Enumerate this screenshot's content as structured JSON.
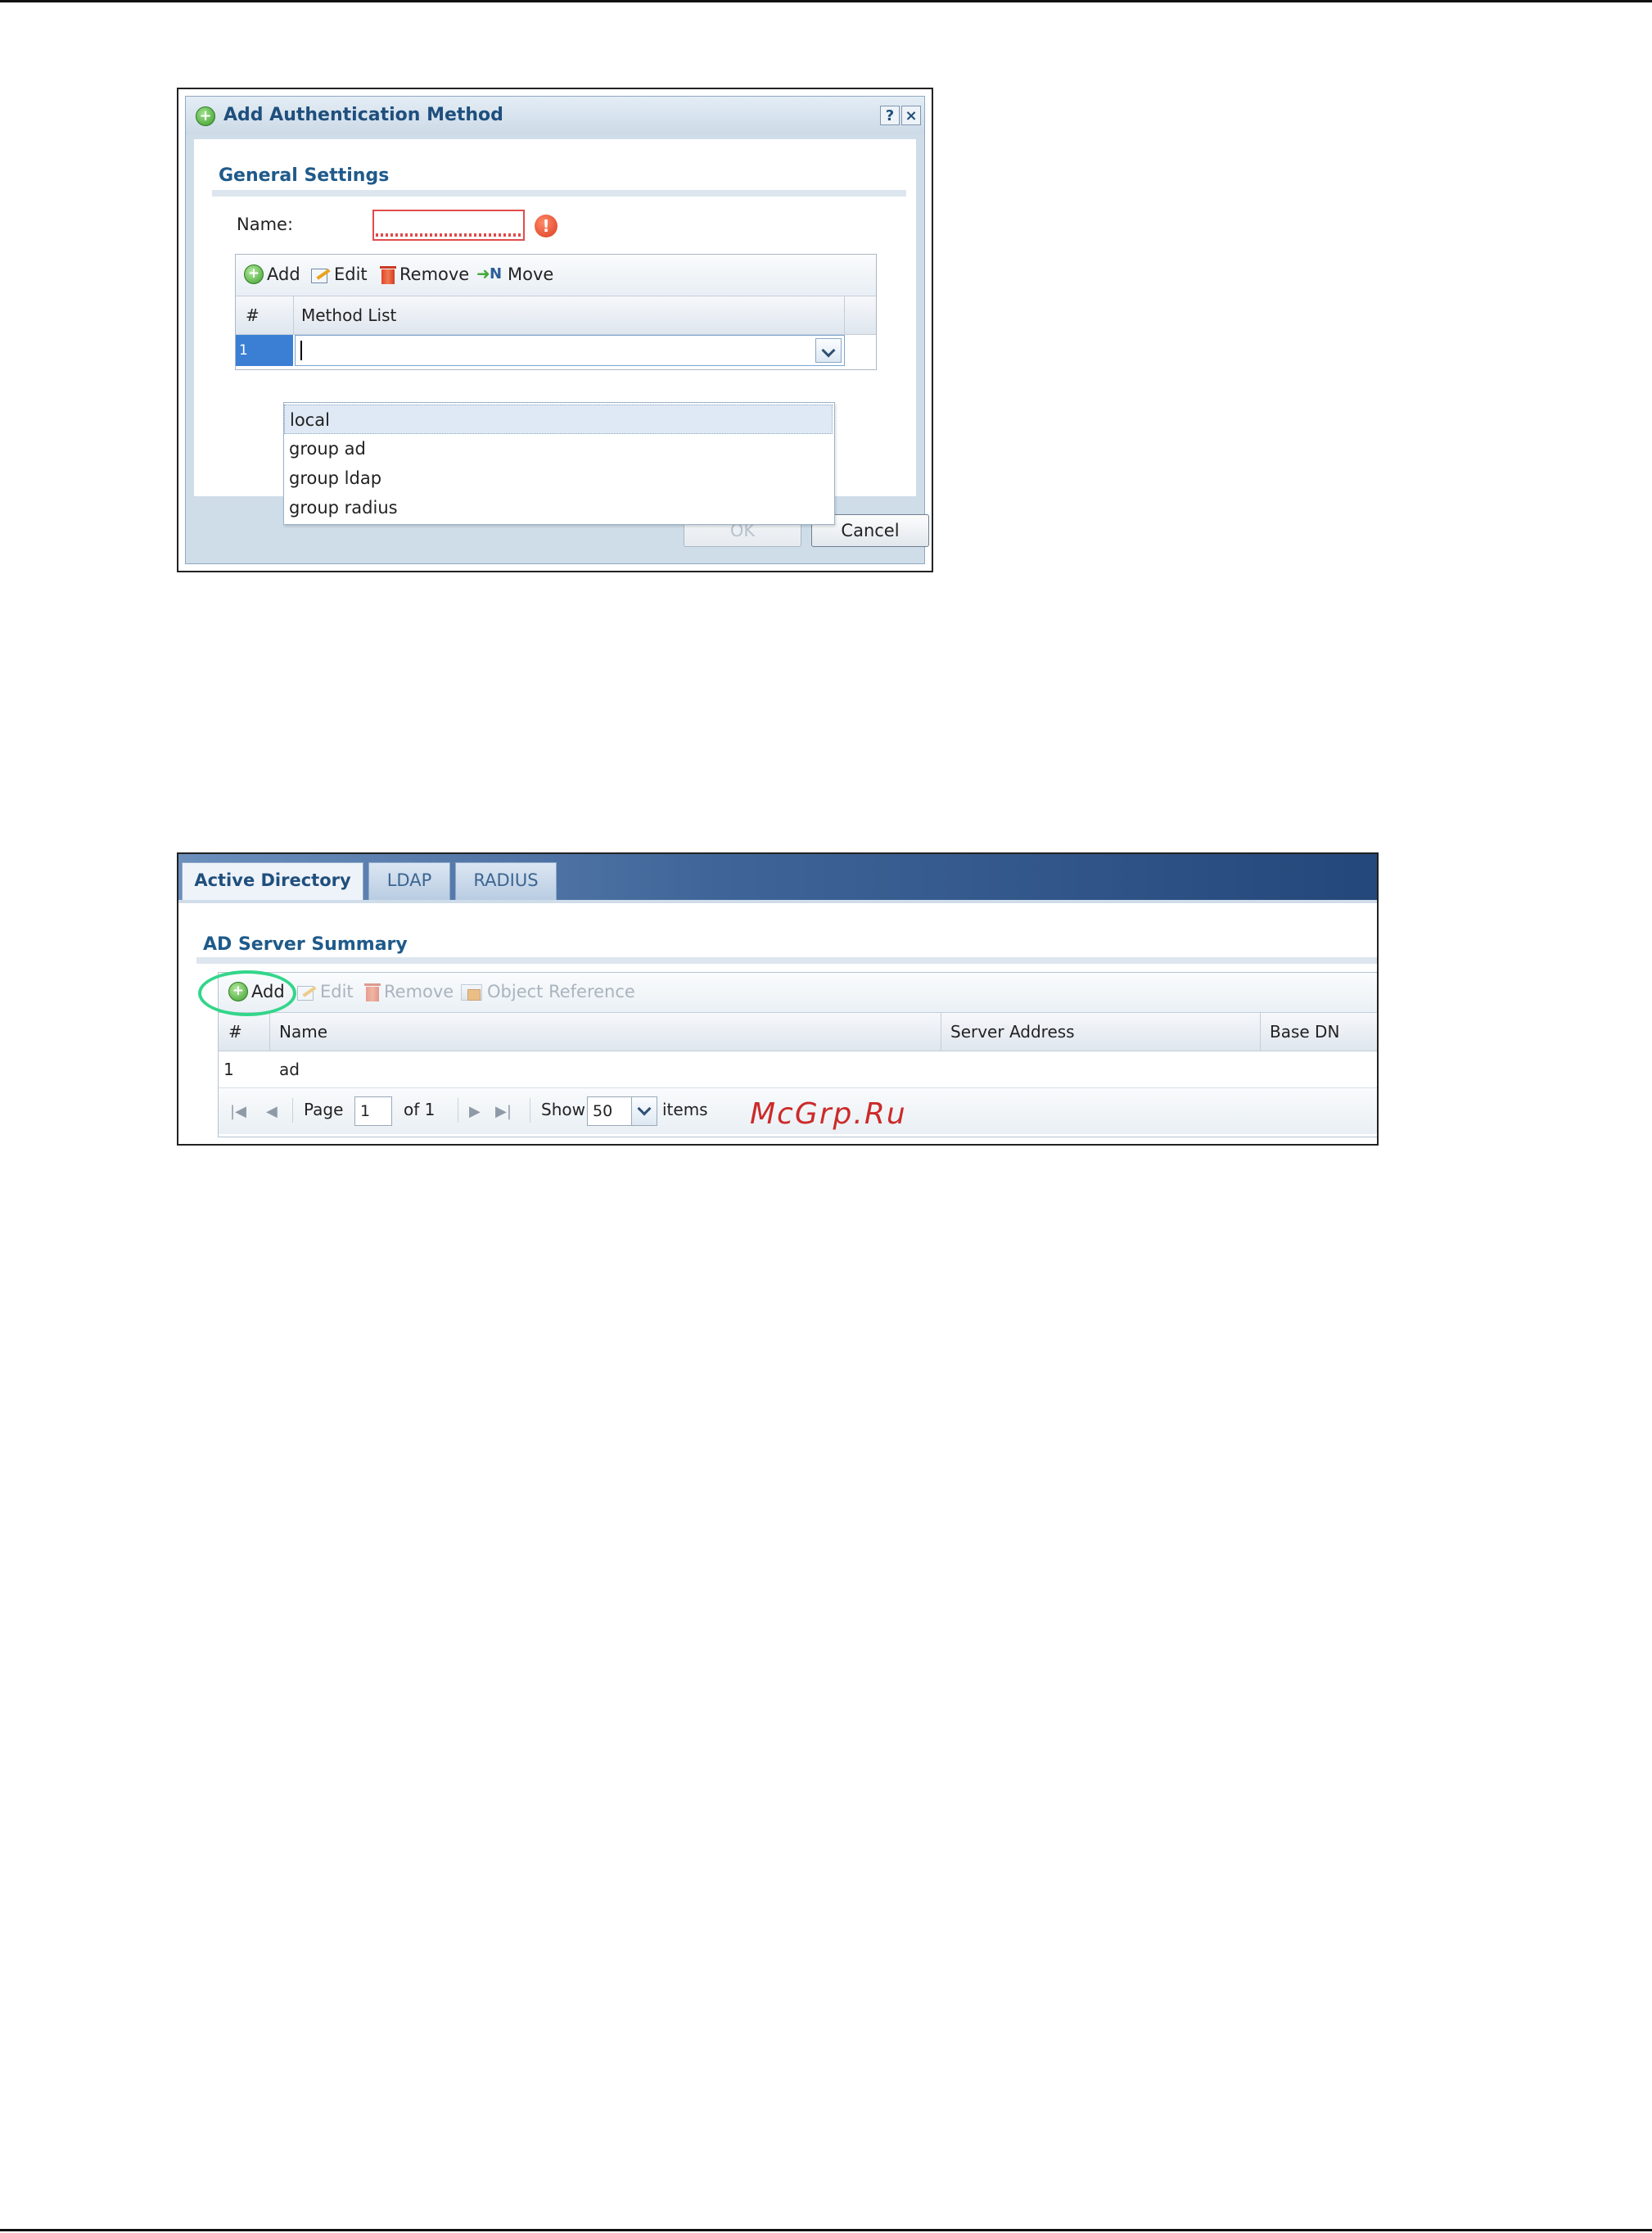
{
  "dialog": {
    "title": "Add Authentication Method",
    "help_glyph": "?",
    "close_glyph": "×",
    "section_title": "General Settings",
    "name_label": "Name:",
    "name_value": "",
    "toolbar": {
      "add": "Add",
      "edit": "Edit",
      "remove": "Remove",
      "move": "Move"
    },
    "columns": {
      "number": "#",
      "method_list": "Method List"
    },
    "row": {
      "number": "1",
      "value": ""
    },
    "dropdown_options": [
      "local",
      "group ad",
      "group ldap",
      "group radius"
    ],
    "selected_option": "local",
    "buttons": {
      "ok": "OK",
      "cancel": "Cancel"
    }
  },
  "ad_screen": {
    "tabs": [
      "Active Directory",
      "LDAP",
      "RADIUS"
    ],
    "active_tab": "Active Directory",
    "section_title": "AD Server Summary",
    "toolbar": {
      "add": "Add",
      "edit": "Edit",
      "remove": "Remove",
      "object_reference": "Object Reference"
    },
    "columns": [
      "#",
      "Name",
      "Server Address",
      "Base DN"
    ],
    "rows": [
      {
        "number": "1",
        "name": "ad",
        "server_address": "",
        "base_dn": ""
      }
    ],
    "pager": {
      "page_label": "Page",
      "page_value": "1",
      "of_label": "of 1",
      "show_label": "Show",
      "show_value": "50",
      "items_label": "items"
    }
  },
  "watermark": "McGrp.Ru",
  "colors": {
    "title_blue": "#1f4f7d",
    "highlight_ring": "#33d68a",
    "error_red": "#e04b4b",
    "watermark_red": "#cc2a2a"
  }
}
